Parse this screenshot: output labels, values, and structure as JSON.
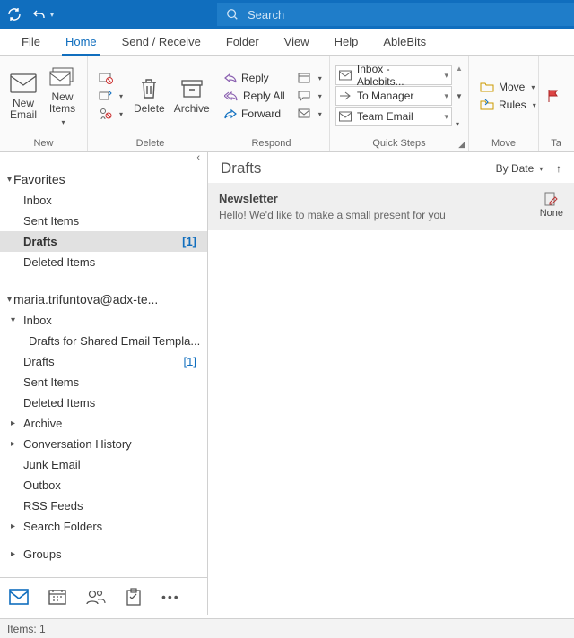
{
  "titlebar": {
    "search_placeholder": "Search"
  },
  "menu": {
    "file": "File",
    "home": "Home",
    "sendreceive": "Send / Receive",
    "folder": "Folder",
    "view": "View",
    "help": "Help",
    "ablebits": "AbleBits"
  },
  "ribbon": {
    "new": {
      "label": "New",
      "new_email": "New\nEmail",
      "new_items": "New\nItems"
    },
    "delete": {
      "label": "Delete",
      "delete": "Delete",
      "archive": "Archive"
    },
    "respond": {
      "label": "Respond",
      "reply": "Reply",
      "reply_all": "Reply All",
      "forward": "Forward"
    },
    "quicksteps": {
      "label": "Quick Steps",
      "items": [
        "Inbox - Ablebits...",
        "To Manager",
        "Team Email"
      ]
    },
    "move": {
      "label": "Move",
      "move": "Move",
      "rules": "Rules"
    },
    "tags": {
      "label": "Ta"
    }
  },
  "nav": {
    "favorites": {
      "label": "Favorites",
      "items": [
        {
          "label": "Inbox"
        },
        {
          "label": "Sent Items"
        },
        {
          "label": "Drafts",
          "count": "[1]",
          "selected": true
        },
        {
          "label": "Deleted Items"
        }
      ]
    },
    "account": {
      "label": "maria.trifuntova@adx-te...",
      "inbox": "Inbox",
      "inbox_sub": "Drafts for Shared Email Templa...",
      "drafts": "Drafts",
      "drafts_count": "[1]",
      "sent": "Sent Items",
      "deleted": "Deleted Items",
      "archive": "Archive",
      "conversation": "Conversation History",
      "junk": "Junk Email",
      "outbox": "Outbox",
      "rss": "RSS Feeds",
      "search_folders": "Search Folders",
      "groups": "Groups"
    }
  },
  "content": {
    "title": "Drafts",
    "sort": "By Date",
    "msg_subject": "Newsletter",
    "msg_preview": "Hello!  We'd like to make a small present for you",
    "msg_date": "None"
  },
  "status": {
    "items": "Items: 1"
  }
}
